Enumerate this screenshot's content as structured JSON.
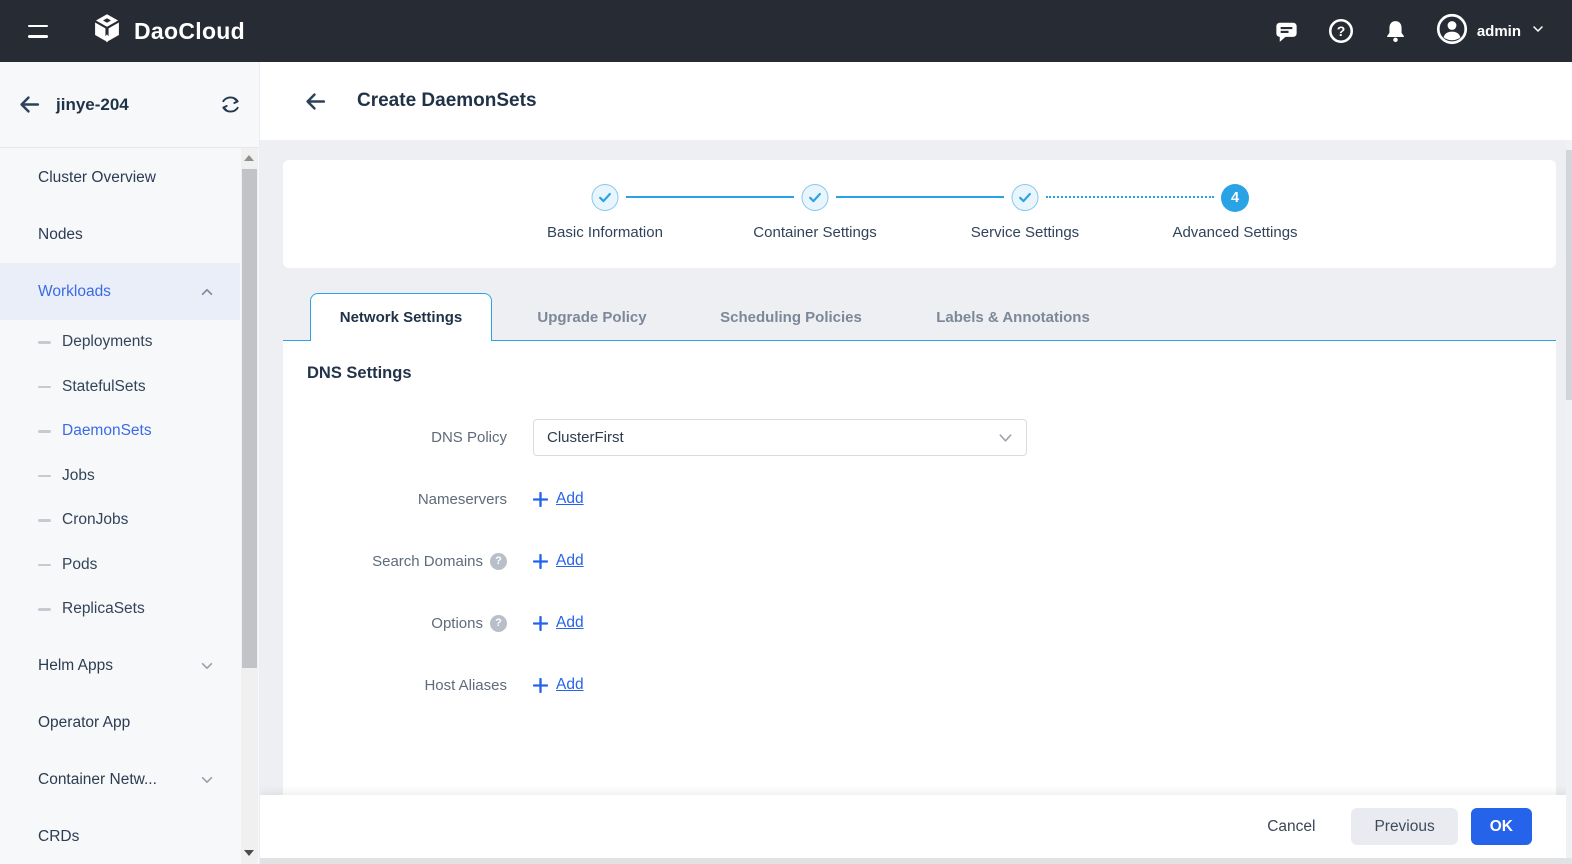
{
  "topbar": {
    "brand": "DaoCloud",
    "user": {
      "name": "admin"
    }
  },
  "icons": {
    "help_glyph": "?"
  },
  "sidebar": {
    "cluster_name": "jinye-204",
    "items": [
      {
        "label": "Cluster Overview"
      },
      {
        "label": "Nodes"
      },
      {
        "label": "Workloads",
        "expanded": true,
        "active": true
      },
      {
        "label": "Deployments"
      },
      {
        "label": "StatefulSets"
      },
      {
        "label": "DaemonSets",
        "selected": true
      },
      {
        "label": "Jobs"
      },
      {
        "label": "CronJobs"
      },
      {
        "label": "Pods"
      },
      {
        "label": "ReplicaSets"
      },
      {
        "label": "Helm Apps",
        "collapsible": true
      },
      {
        "label": "Operator App"
      },
      {
        "label": "Container Netw...",
        "collapsible": true
      },
      {
        "label": "CRDs"
      }
    ]
  },
  "page": {
    "title": "Create DaemonSets"
  },
  "stepper": {
    "steps": [
      {
        "label": "Basic Information",
        "state": "done"
      },
      {
        "label": "Container Settings",
        "state": "done"
      },
      {
        "label": "Service Settings",
        "state": "done"
      },
      {
        "label": "Advanced Settings",
        "state": "current",
        "number": "4"
      }
    ]
  },
  "tabs": [
    {
      "label": "Network Settings",
      "active": true
    },
    {
      "label": "Upgrade Policy"
    },
    {
      "label": "Scheduling Policies"
    },
    {
      "label": "Labels & Annotations"
    }
  ],
  "form": {
    "section_title": "DNS Settings",
    "fields": [
      {
        "label": "DNS Policy",
        "type": "select",
        "value": "ClusterFirst"
      },
      {
        "label": "Nameservers",
        "type": "add",
        "add_label": "Add"
      },
      {
        "label": "Search Domains",
        "type": "add",
        "help": true,
        "add_label": "Add"
      },
      {
        "label": "Options",
        "type": "add",
        "help": true,
        "add_label": "Add"
      },
      {
        "label": "Host Aliases",
        "type": "add",
        "add_label": "Add"
      }
    ]
  },
  "footer": {
    "cancel_label": "Cancel",
    "previous_label": "Previous",
    "ok_label": "OK"
  },
  "colors": {
    "topbar_bg": "#272b33",
    "accent_blue": "#2563eb",
    "sky_blue": "#29a3e6",
    "sidebar_active_bg": "#e9eef8",
    "sidebar_active_text": "#3a6be7"
  }
}
